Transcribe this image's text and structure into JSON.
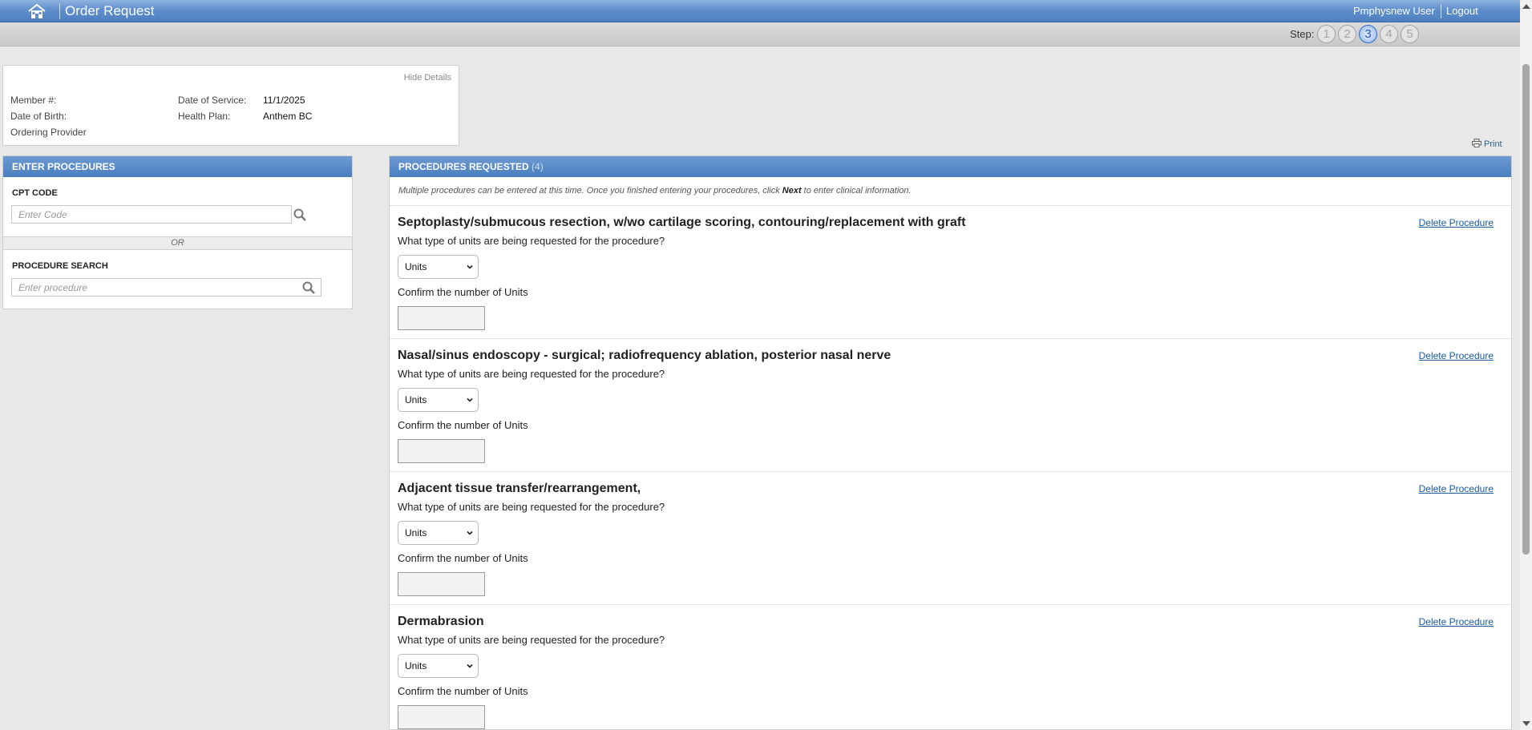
{
  "header": {
    "title": "Order Request",
    "user": "Pmphysnew User",
    "logout_label": "Logout",
    "home_icon": "home-icon"
  },
  "steps": {
    "label": "Step:",
    "items": [
      "1",
      "2",
      "3",
      "4",
      "5"
    ],
    "current": "3"
  },
  "member": {
    "hide_label": "Hide Details",
    "member_label": "Member #:",
    "dob_label": "Date of Birth:",
    "provider_label": "Ordering Provider",
    "dos_label": "Date of Service:",
    "dos_value": "11/1/2025",
    "plan_label": "Health Plan:",
    "plan_value": "Anthem BC"
  },
  "print_label": "Print",
  "enter_panel": {
    "title": "ENTER PROCEDURES",
    "cpt_label": "CPT CODE",
    "cpt_placeholder": "Enter Code",
    "or_label": "OR",
    "search_label": "PROCEDURE SEARCH",
    "search_placeholder": "Enter procedure"
  },
  "requested_panel": {
    "title": "PROCEDURES REQUESTED",
    "count": "(4)",
    "instructions_pre": "Multiple procedures can be entered at this time. Once you finished entering your procedures, click",
    "instructions_bold": "Next",
    "instructions_post": "to enter clinical information."
  },
  "procedures": [
    {
      "title": "Septoplasty/submucous resection, w/wo cartilage scoring, contouring/replacement with graft",
      "delete_label": "Delete Procedure",
      "question": "What type of units are being requested for the procedure?",
      "units_value": "Units",
      "confirm_label": "Confirm the number of Units"
    },
    {
      "title": "Nasal/sinus endoscopy - surgical; radiofrequency ablation, posterior nasal nerve",
      "delete_label": "Delete Procedure",
      "question": "What type of units are being requested for the procedure?",
      "units_value": "Units",
      "confirm_label": "Confirm the number of Units"
    },
    {
      "title": "Adjacent tissue transfer/rearrangement,",
      "delete_label": "Delete Procedure",
      "question": "What type of units are being requested for the procedure?",
      "units_value": "Units",
      "confirm_label": "Confirm the number of Units"
    },
    {
      "title": "Dermabrasion",
      "delete_label": "Delete Procedure",
      "question": "What type of units are being requested for the procedure?",
      "units_value": "Units",
      "confirm_label": "Confirm the number of Units"
    }
  ]
}
